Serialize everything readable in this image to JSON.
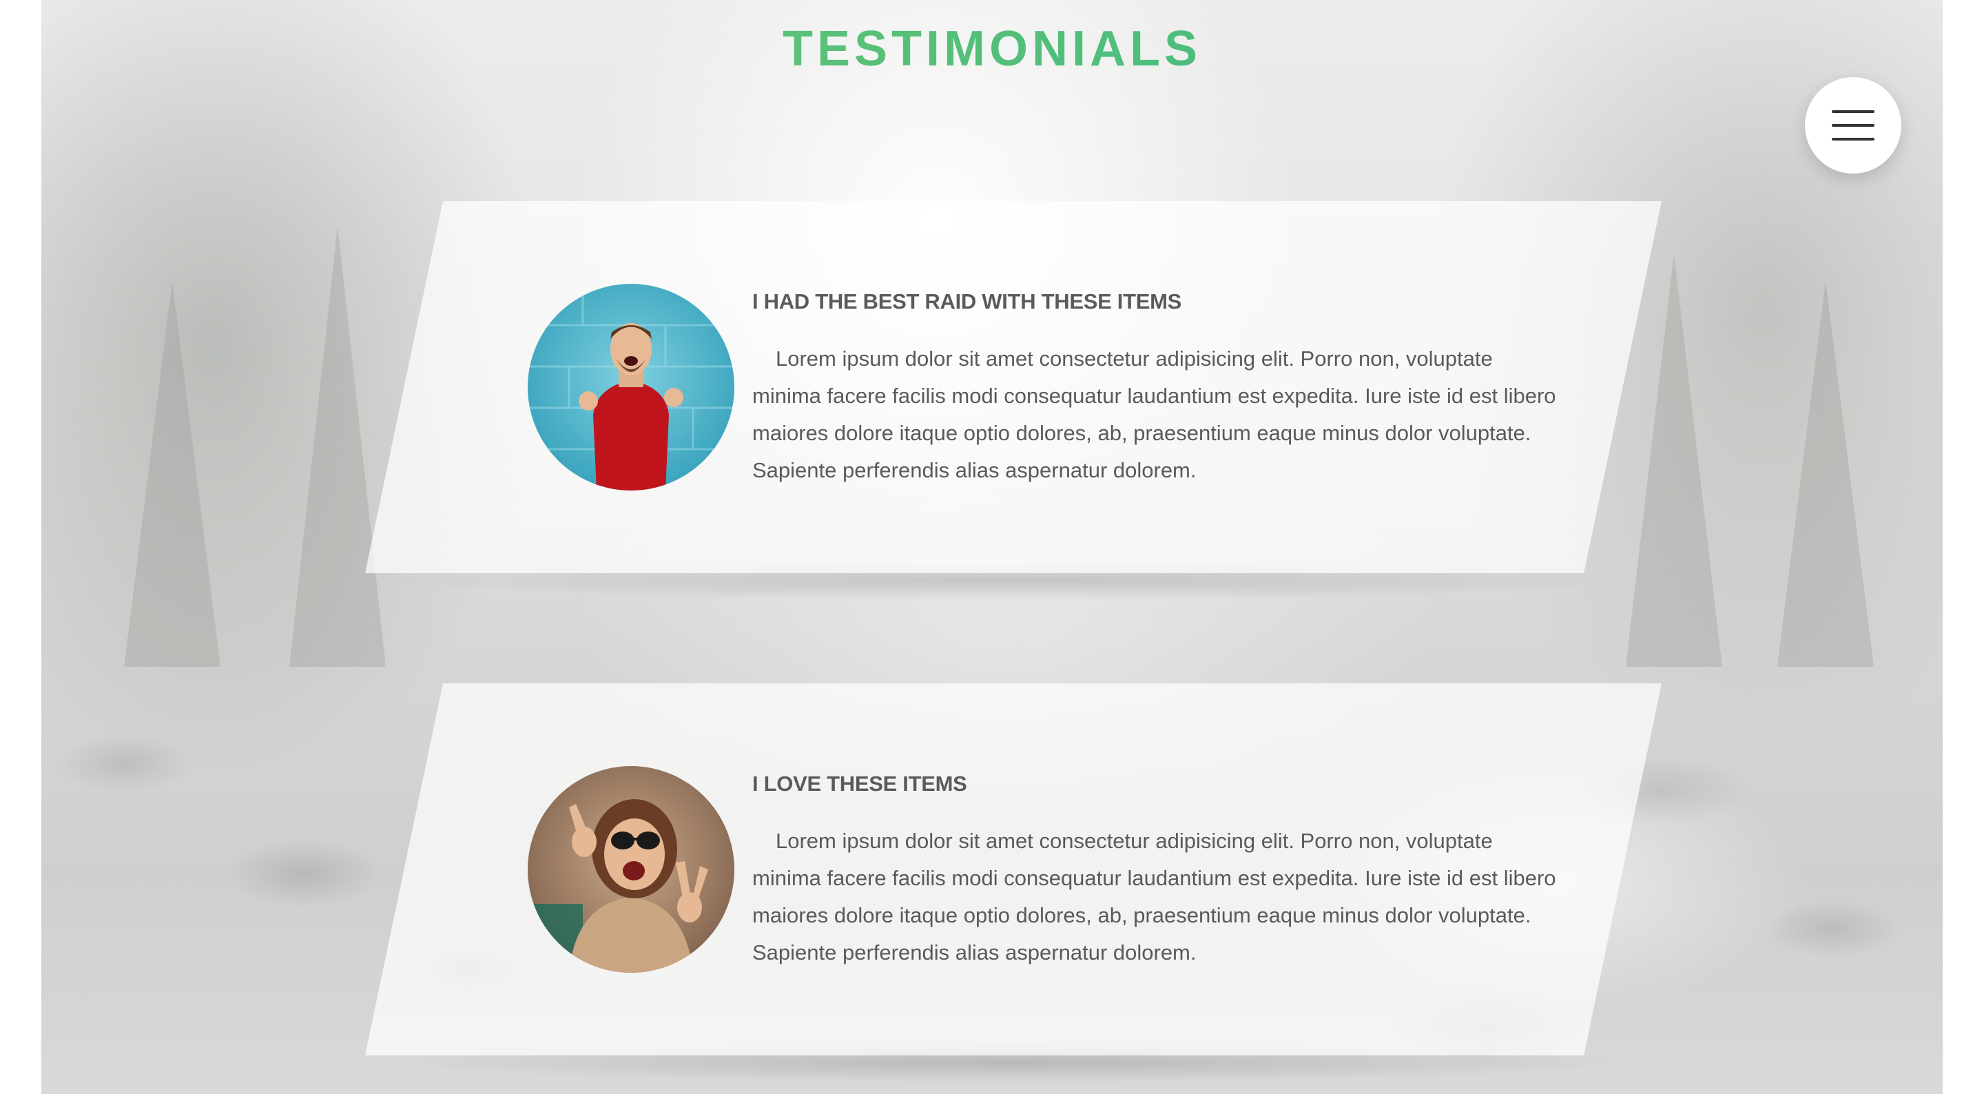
{
  "header": {
    "title": "TESTIMONIALS"
  },
  "menu": {
    "icon": "hamburger-menu-icon"
  },
  "colors": {
    "title_gradient_start": "#72c86b",
    "title_gradient_end": "#35b68a",
    "text": "#5a5a5a",
    "card_background": "#ffffff"
  },
  "testimonials": [
    {
      "heading": "I HAD THE BEST RAID WITH THESE ITEMS",
      "body": "Lorem ipsum dolor sit amet consectetur adipisicing elit. Porro non, voluptate minima facere facilis modi consequatur laudantium est expedita. Iure iste id est libero maiores dolore itaque optio dolores, ab, praesentium eaque minus dolor voluptate. Sapiente perferendis alias aspernatur dolorem.",
      "avatar": "man-red-sweater-photo"
    },
    {
      "heading": "I LOVE THESE ITEMS",
      "body": "Lorem ipsum dolor sit amet consectetur adipisicing elit. Porro non, voluptate minima facere facilis modi consequatur laudantium est expedita. Iure iste id est libero maiores dolore itaque optio dolores, ab, praesentium eaque minus dolor voluptate. Sapiente perferendis alias aspernatur dolorem.",
      "avatar": "woman-sunglasses-photo"
    }
  ]
}
